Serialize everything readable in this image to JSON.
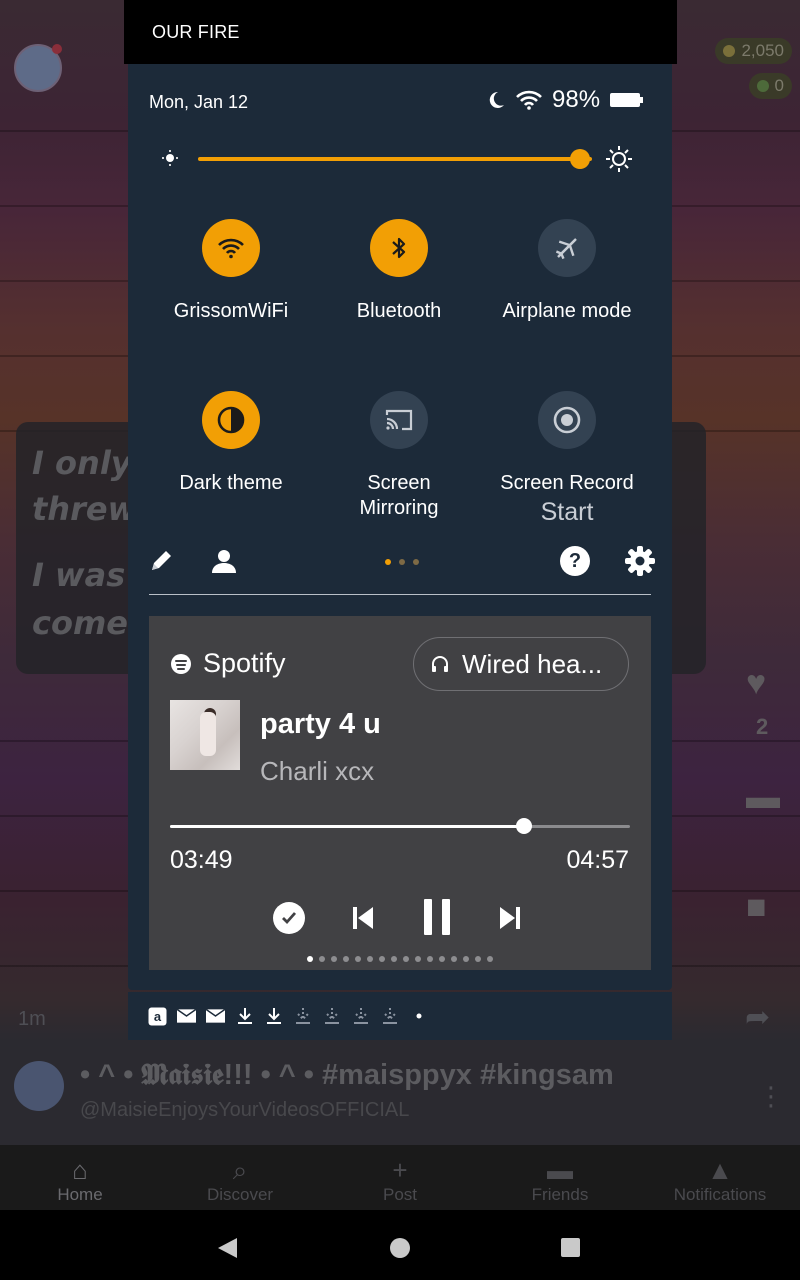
{
  "background_app": {
    "coins": "2,050",
    "gems": "0",
    "caption_lines": [
      "I only",
      "threw",
      "I was",
      "come"
    ],
    "like_count": "2",
    "post_time": "1m",
    "username": "• ^ • 𝕸𝖆𝖎𝖘𝖎𝖊!!! • ^ • #maisppyx #kingsam",
    "handle": "@MaisieEnjoysYourVideosOFFICIAL",
    "nav": [
      {
        "label": "Home",
        "icon": "home-icon"
      },
      {
        "label": "Discover",
        "icon": "search-icon"
      },
      {
        "label": "Post",
        "icon": "plus-icon"
      },
      {
        "label": "Friends",
        "icon": "chat-icon"
      },
      {
        "label": "Notifications",
        "icon": "bell-icon"
      }
    ]
  },
  "shade": {
    "top_title": "OUR FIRE",
    "date": "Mon, Jan 12",
    "battery": "98%",
    "brightness_level": 0.97,
    "tiles": [
      {
        "label": "GrissomWiFi",
        "icon": "wifi-icon",
        "state": "on"
      },
      {
        "label": "Bluetooth",
        "icon": "bluetooth-icon",
        "state": "on"
      },
      {
        "label": "Airplane mode",
        "icon": "airplane-icon",
        "state": "off"
      },
      {
        "label": "Dark theme",
        "icon": "dark-theme-icon",
        "state": "on"
      },
      {
        "label": "Screen Mirroring",
        "icon": "cast-icon",
        "state": "off"
      },
      {
        "label": "Screen Record",
        "sublabel": "Start",
        "icon": "record-icon",
        "state": "off"
      }
    ],
    "accent_color": "#f29f05"
  },
  "media": {
    "app": "Spotify",
    "output": "Wired hea...",
    "title": "party 4 u",
    "artist": "Charli xcx",
    "elapsed": "03:49",
    "duration": "04:57",
    "progress": 0.77,
    "queue_dots": 16,
    "queue_current": 0
  }
}
